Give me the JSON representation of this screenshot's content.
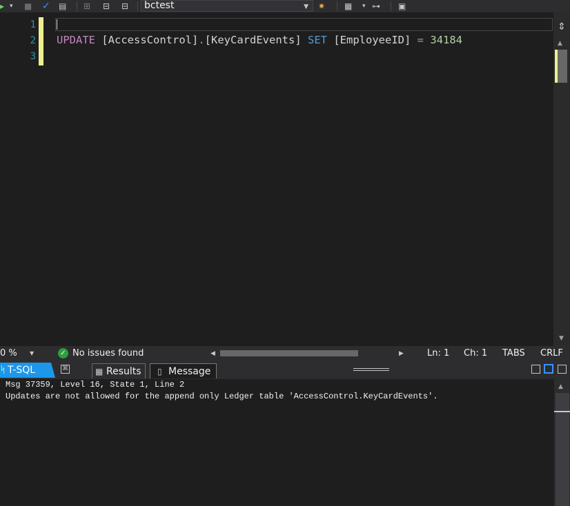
{
  "toolbar": {
    "database": "bctest",
    "icons": [
      "run-arrow-icon",
      "stop-icon",
      "parse-check-icon",
      "display-plan-icon",
      "query-options-icon",
      "results-to-icon",
      "results-grid-icon",
      "include-plan-icon",
      "comment-icon"
    ]
  },
  "editor": {
    "line_numbers": [
      "1",
      "2",
      "3"
    ],
    "code": {
      "kw_update": "UPDATE",
      "t1": "[AccessControl]",
      "dot": ".",
      "t2": "[KeyCardEvents]",
      "kw_set": "SET",
      "col": "[EmployeeID]",
      "eq": "=",
      "val": "34184"
    }
  },
  "statusbar": {
    "zoom": "0 %",
    "issues": "No issues found",
    "ln": "Ln: 1",
    "ch": "Ch: 1",
    "tabs": "TABS",
    "crlf": "CRLF"
  },
  "results_tabs": {
    "lang": "T-SQL",
    "results": "Results",
    "message": "Message"
  },
  "messages": [
    "Msg 37359, Level 16, State 1, Line 2",
    "Updates are not allowed for the append only Ledger table 'AccessControl.KeyCardEvents'."
  ],
  "colors": {
    "accent": "#1c97ea",
    "change_marker": "#efef91",
    "keyword_purple": "#c586c0",
    "keyword_blue": "#569cd6",
    "number_green": "#b5cea8",
    "line_number": "#2b91af"
  }
}
